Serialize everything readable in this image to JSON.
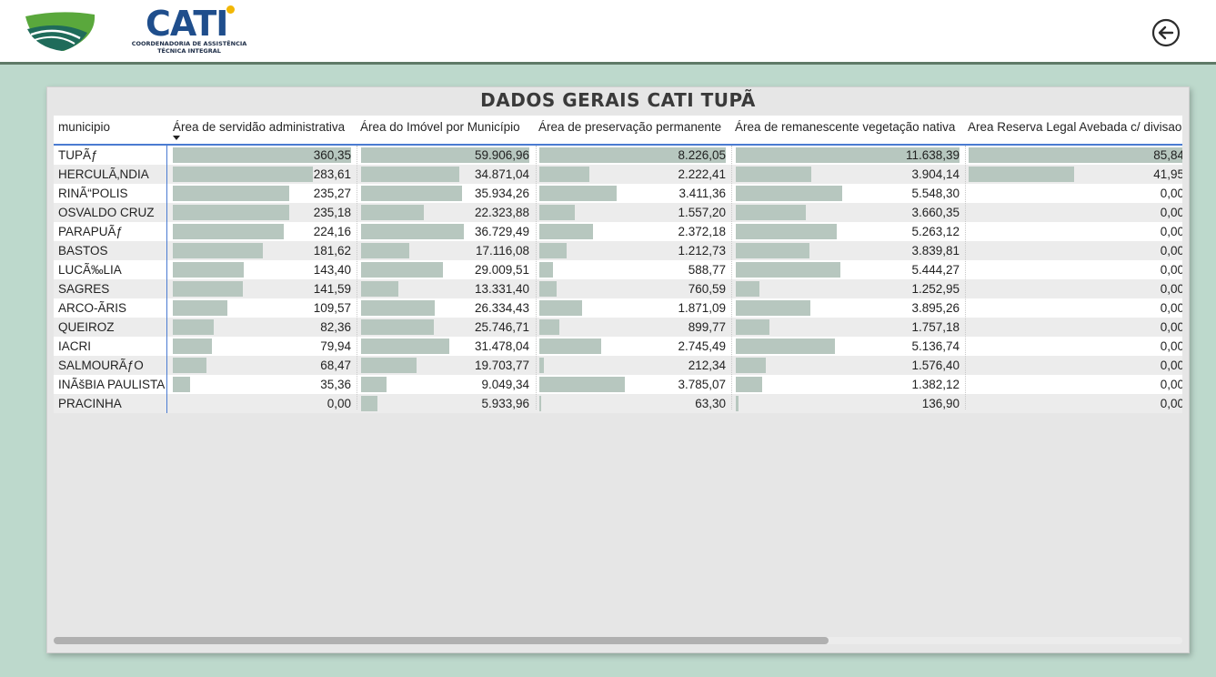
{
  "header": {
    "logo_left": "sp-green-logo",
    "logo_brand": "CATI",
    "logo_brand_sub1": "COORDENADORIA DE ASSISTÊNCIA",
    "logo_brand_sub2": "TÉCNICA INTEGRAL",
    "back_icon": "arrow-left-circle-icon"
  },
  "panel": {
    "title": "DADOS GERAIS CATI TUPÃ"
  },
  "table": {
    "columns": [
      "municipio",
      "Área de servidão administrativa",
      "Área do Imóvel por Município",
      "Área de preservação permanente",
      "Área de remanescente vegetação nativa",
      "Area Reserva Legal Avebada c/ divisao"
    ],
    "sorted_column": "Área de servidão administrativa",
    "rows": [
      {
        "municipio": "TUPÃƒ",
        "servidao": "360,35",
        "imovel": "59.906,96",
        "app": "8.226,05",
        "remanescente": "11.638,39",
        "reserva": "85,84",
        "v": [
          360.35,
          59906.96,
          8226.05,
          11638.39,
          85.84
        ]
      },
      {
        "municipio": "HERCULÃ‚NDIA",
        "servidao": "283,61",
        "imovel": "34.871,04",
        "app": "2.222,41",
        "remanescente": "3.904,14",
        "reserva": "41,95",
        "v": [
          283.61,
          34871.04,
          2222.41,
          3904.14,
          41.95
        ]
      },
      {
        "municipio": "RINÃ“POLIS",
        "servidao": "235,27",
        "imovel": "35.934,26",
        "app": "3.411,36",
        "remanescente": "5.548,30",
        "reserva": "0,00",
        "v": [
          235.27,
          35934.26,
          3411.36,
          5548.3,
          0
        ]
      },
      {
        "municipio": "OSVALDO CRUZ",
        "servidao": "235,18",
        "imovel": "22.323,88",
        "app": "1.557,20",
        "remanescente": "3.660,35",
        "reserva": "0,00",
        "v": [
          235.18,
          22323.88,
          1557.2,
          3660.35,
          0
        ]
      },
      {
        "municipio": "PARAPUÃƒ",
        "servidao": "224,16",
        "imovel": "36.729,49",
        "app": "2.372,18",
        "remanescente": "5.263,12",
        "reserva": "0,00",
        "v": [
          224.16,
          36729.49,
          2372.18,
          5263.12,
          0
        ]
      },
      {
        "municipio": "BASTOS",
        "servidao": "181,62",
        "imovel": "17.116,08",
        "app": "1.212,73",
        "remanescente": "3.839,81",
        "reserva": "0,00",
        "v": [
          181.62,
          17116.08,
          1212.73,
          3839.81,
          0
        ]
      },
      {
        "municipio": "LUCÃ‰LIA",
        "servidao": "143,40",
        "imovel": "29.009,51",
        "app": "588,77",
        "remanescente": "5.444,27",
        "reserva": "0,00",
        "v": [
          143.4,
          29009.51,
          588.77,
          5444.27,
          0
        ]
      },
      {
        "municipio": "SAGRES",
        "servidao": "141,59",
        "imovel": "13.331,40",
        "app": "760,59",
        "remanescente": "1.252,95",
        "reserva": "0,00",
        "v": [
          141.59,
          13331.4,
          760.59,
          1252.95,
          0
        ]
      },
      {
        "municipio": "ARCO-ÃRIS",
        "servidao": "109,57",
        "imovel": "26.334,43",
        "app": "1.871,09",
        "remanescente": "3.895,26",
        "reserva": "0,00",
        "v": [
          109.57,
          26334.43,
          1871.09,
          3895.26,
          0
        ]
      },
      {
        "municipio": "QUEIROZ",
        "servidao": "82,36",
        "imovel": "25.746,71",
        "app": "899,77",
        "remanescente": "1.757,18",
        "reserva": "0,00",
        "v": [
          82.36,
          25746.71,
          899.77,
          1757.18,
          0
        ]
      },
      {
        "municipio": "IACRI",
        "servidao": "79,94",
        "imovel": "31.478,04",
        "app": "2.745,49",
        "remanescente": "5.136,74",
        "reserva": "0,00",
        "v": [
          79.94,
          31478.04,
          2745.49,
          5136.74,
          0
        ]
      },
      {
        "municipio": "SALMOURÃƒO",
        "servidao": "68,47",
        "imovel": "19.703,77",
        "app": "212,34",
        "remanescente": "1.576,40",
        "reserva": "0,00",
        "v": [
          68.47,
          19703.77,
          212.34,
          1576.4,
          0
        ]
      },
      {
        "municipio": "INÃšBIA PAULISTA",
        "servidao": "35,36",
        "imovel": "9.049,34",
        "app": "3.785,07",
        "remanescente": "1.382,12",
        "reserva": "0,00",
        "v": [
          35.36,
          9049.34,
          3785.07,
          1382.12,
          0
        ]
      },
      {
        "municipio": "PRACINHA",
        "servidao": "0,00",
        "imovel": "5.933,96",
        "app": "63,30",
        "remanescente": "136,90",
        "reserva": "0,00",
        "v": [
          0,
          5933.96,
          63.3,
          136.9,
          0
        ]
      }
    ]
  },
  "scrollbar": {
    "horizontal_position": 0.0,
    "visible_fraction": 0.69
  },
  "colors": {
    "bar": "#b7c7bf",
    "background": "#bdd9cc",
    "frozen_line": "#4a7bd1"
  }
}
